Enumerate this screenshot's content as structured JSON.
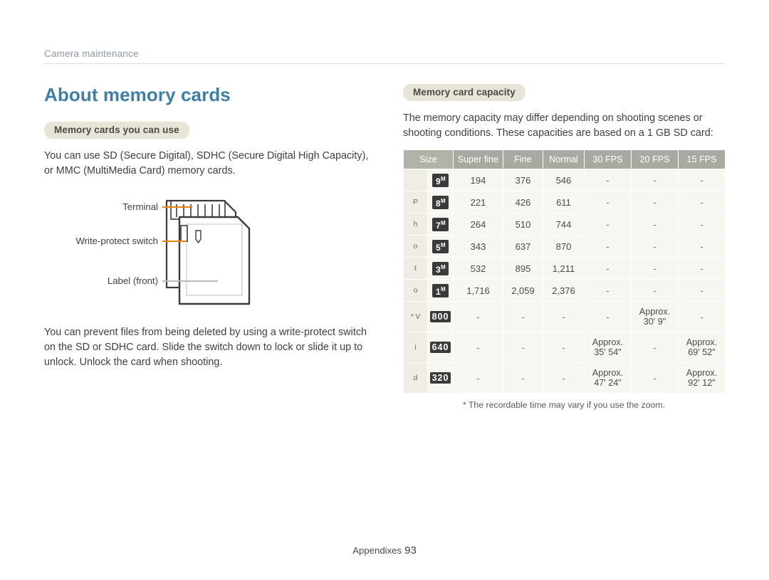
{
  "header": {
    "running_title": "Camera maintenance"
  },
  "left": {
    "heading": "About memory cards",
    "pill": "Memory cards you can use",
    "paragraph1": "You can use SD (Secure Digital), SDHC (Secure Digital High Capacity), or MMC (MultiMedia Card) memory cards.",
    "figure": {
      "terminal": "Terminal",
      "write_protect": "Write-protect switch",
      "label_front": "Label (front)"
    },
    "paragraph2": "You can prevent files from being deleted by using a write-protect switch on the SD or SDHC card. Slide the switch down to lock or slide it up to unlock. Unlock the card when shooting."
  },
  "right": {
    "pill": "Memory card capacity",
    "intro": "The memory capacity may differ depending on shooting scenes or shooting conditions. These capacities are based on a 1 GB SD card:",
    "footnote": "* The recordable time may vary if you use the zoom.",
    "group_photos": "Photos",
    "group_videos": "Videos",
    "star": "*",
    "table": {
      "headers": [
        "Size",
        "Super fine",
        "Fine",
        "Normal",
        "30 FPS",
        "20 FPS",
        "15 FPS"
      ],
      "rows": [
        {
          "size": "9",
          "sup": "M",
          "cells": [
            "194",
            "376",
            "546",
            "-",
            "-",
            "-"
          ]
        },
        {
          "size": "8",
          "sup": "M",
          "cells": [
            "221",
            "426",
            "611",
            "-",
            "-",
            "-"
          ]
        },
        {
          "size": "7",
          "sup": "M",
          "cells": [
            "264",
            "510",
            "744",
            "-",
            "-",
            "-"
          ]
        },
        {
          "size": "5",
          "sup": "M",
          "cells": [
            "343",
            "637",
            "870",
            "-",
            "-",
            "-"
          ]
        },
        {
          "size": "3",
          "sup": "M",
          "cells": [
            "532",
            "895",
            "1,211",
            "-",
            "-",
            "-"
          ]
        },
        {
          "size": "1",
          "sup": "M",
          "cells": [
            "1,716",
            "2,059",
            "2,376",
            "-",
            "-",
            "-"
          ]
        },
        {
          "size": "800",
          "sup": "",
          "cells": [
            "-",
            "-",
            "-",
            "-",
            "Approx.|30' 9\"",
            "-"
          ]
        },
        {
          "size": "640",
          "sup": "",
          "cells": [
            "-",
            "-",
            "-",
            "Approx.|35' 54\"",
            "-",
            "Approx.|69' 52\""
          ]
        },
        {
          "size": "320",
          "sup": "",
          "cells": [
            "-",
            "-",
            "-",
            "Approx.|47' 24\"",
            "-",
            "Approx.|92' 12\""
          ]
        }
      ]
    }
  },
  "footer": {
    "label": "Appendixes",
    "page": "93"
  },
  "colors": {
    "accent": "#3f7fa6",
    "pill_bg": "#e9e4d8",
    "table_head": "#a9a9a1",
    "leader": "#e8860b"
  }
}
